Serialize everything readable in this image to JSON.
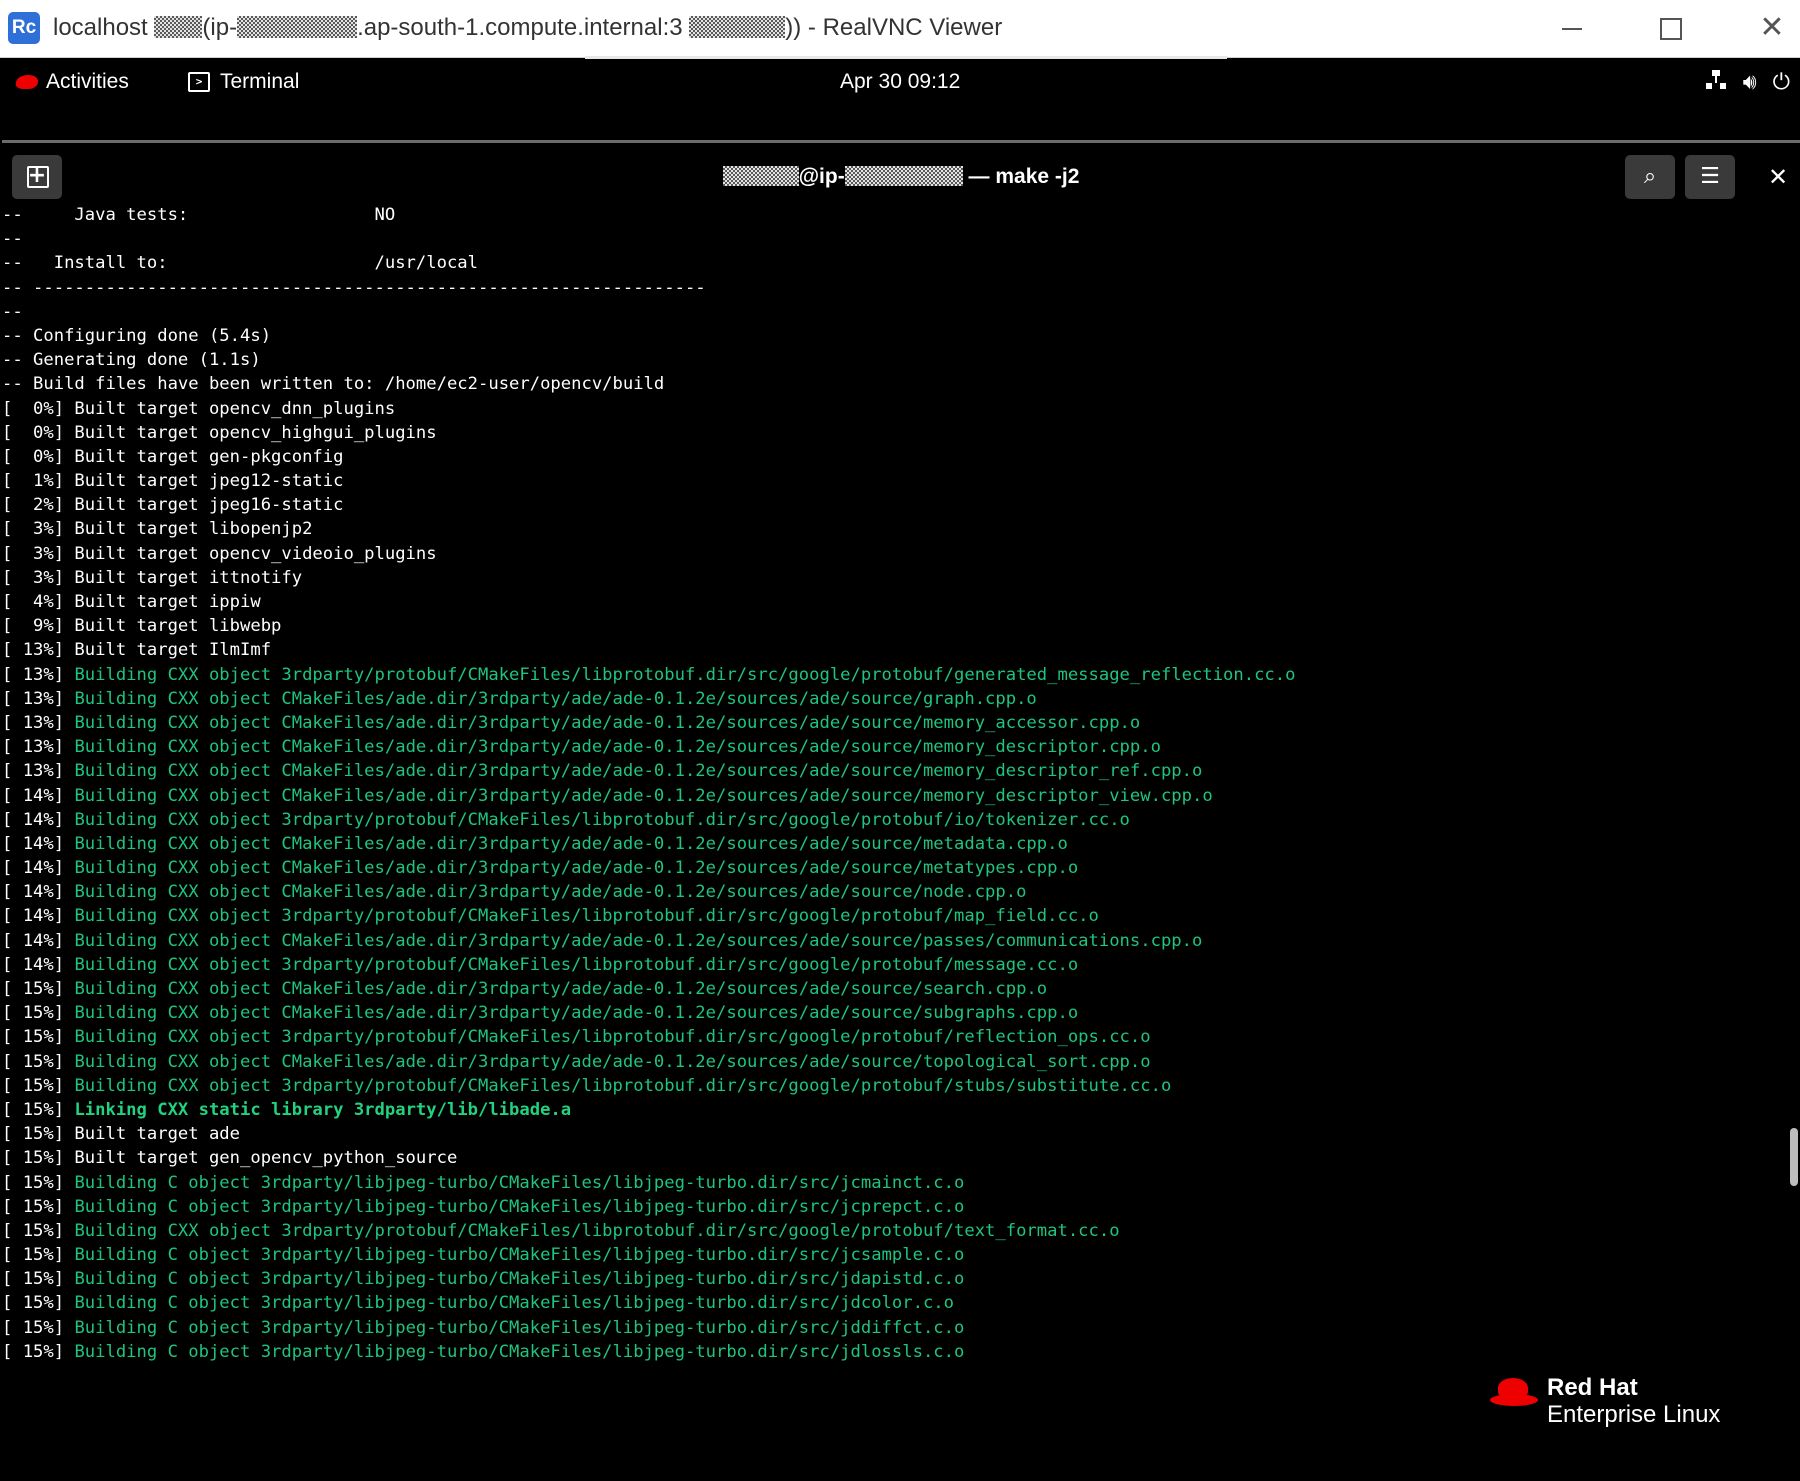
{
  "vnc": {
    "title_prefix": "localhost ",
    "title_mid": "(ip-",
    "title_host": ".ap-south-1.compute.internal:3",
    "title_suffix": ")) - RealVNC Viewer",
    "logo": "Rc"
  },
  "gnome": {
    "activities": "Activities",
    "app": "Terminal",
    "clock": "Apr 30  09:12"
  },
  "terminal": {
    "title_at": "@ip-",
    "title_cmd": " — make -j2",
    "lines": [
      {
        "prefix": "--     Java tests:                  NO",
        "msg": "",
        "style": ""
      },
      {
        "prefix": "--",
        "msg": "",
        "style": ""
      },
      {
        "prefix": "--   Install to:                    /usr/local",
        "msg": "",
        "style": ""
      },
      {
        "prefix": "-- -----------------------------------------------------------------",
        "msg": "",
        "style": ""
      },
      {
        "prefix": "--",
        "msg": "",
        "style": ""
      },
      {
        "prefix": "-- Configuring done (5.4s)",
        "msg": "",
        "style": ""
      },
      {
        "prefix": "-- Generating done (1.1s)",
        "msg": "",
        "style": ""
      },
      {
        "prefix": "-- Build files have been written to: /home/ec2-user/opencv/build",
        "msg": "",
        "style": ""
      },
      {
        "prefix": "[  0%] Built target opencv_dnn_plugins",
        "msg": "",
        "style": ""
      },
      {
        "prefix": "[  0%] Built target opencv_highgui_plugins",
        "msg": "",
        "style": ""
      },
      {
        "prefix": "[  0%] Built target gen-pkgconfig",
        "msg": "",
        "style": ""
      },
      {
        "prefix": "[  1%] Built target jpeg12-static",
        "msg": "",
        "style": ""
      },
      {
        "prefix": "[  2%] Built target jpeg16-static",
        "msg": "",
        "style": ""
      },
      {
        "prefix": "[  3%] Built target libopenjp2",
        "msg": "",
        "style": ""
      },
      {
        "prefix": "[  3%] Built target opencv_videoio_plugins",
        "msg": "",
        "style": ""
      },
      {
        "prefix": "[  3%] Built target ittnotify",
        "msg": "",
        "style": ""
      },
      {
        "prefix": "[  4%] Built target ippiw",
        "msg": "",
        "style": ""
      },
      {
        "prefix": "[  9%] Built target libwebp",
        "msg": "",
        "style": ""
      },
      {
        "prefix": "[ 13%] Built target IlmImf",
        "msg": "",
        "style": ""
      },
      {
        "prefix": "[ 13%] ",
        "msg": "Building CXX object 3rdparty/protobuf/CMakeFiles/libprotobuf.dir/src/google/protobuf/generated_message_reflection.cc.o",
        "style": "green"
      },
      {
        "prefix": "[ 13%] ",
        "msg": "Building CXX object CMakeFiles/ade.dir/3rdparty/ade/ade-0.1.2e/sources/ade/source/graph.cpp.o",
        "style": "green"
      },
      {
        "prefix": "[ 13%] ",
        "msg": "Building CXX object CMakeFiles/ade.dir/3rdparty/ade/ade-0.1.2e/sources/ade/source/memory_accessor.cpp.o",
        "style": "green"
      },
      {
        "prefix": "[ 13%] ",
        "msg": "Building CXX object CMakeFiles/ade.dir/3rdparty/ade/ade-0.1.2e/sources/ade/source/memory_descriptor.cpp.o",
        "style": "green"
      },
      {
        "prefix": "[ 13%] ",
        "msg": "Building CXX object CMakeFiles/ade.dir/3rdparty/ade/ade-0.1.2e/sources/ade/source/memory_descriptor_ref.cpp.o",
        "style": "green"
      },
      {
        "prefix": "[ 14%] ",
        "msg": "Building CXX object CMakeFiles/ade.dir/3rdparty/ade/ade-0.1.2e/sources/ade/source/memory_descriptor_view.cpp.o",
        "style": "green"
      },
      {
        "prefix": "[ 14%] ",
        "msg": "Building CXX object 3rdparty/protobuf/CMakeFiles/libprotobuf.dir/src/google/protobuf/io/tokenizer.cc.o",
        "style": "green"
      },
      {
        "prefix": "[ 14%] ",
        "msg": "Building CXX object CMakeFiles/ade.dir/3rdparty/ade/ade-0.1.2e/sources/ade/source/metadata.cpp.o",
        "style": "green"
      },
      {
        "prefix": "[ 14%] ",
        "msg": "Building CXX object CMakeFiles/ade.dir/3rdparty/ade/ade-0.1.2e/sources/ade/source/metatypes.cpp.o",
        "style": "green"
      },
      {
        "prefix": "[ 14%] ",
        "msg": "Building CXX object CMakeFiles/ade.dir/3rdparty/ade/ade-0.1.2e/sources/ade/source/node.cpp.o",
        "style": "green"
      },
      {
        "prefix": "[ 14%] ",
        "msg": "Building CXX object 3rdparty/protobuf/CMakeFiles/libprotobuf.dir/src/google/protobuf/map_field.cc.o",
        "style": "green"
      },
      {
        "prefix": "[ 14%] ",
        "msg": "Building CXX object CMakeFiles/ade.dir/3rdparty/ade/ade-0.1.2e/sources/ade/source/passes/communications.cpp.o",
        "style": "green"
      },
      {
        "prefix": "[ 14%] ",
        "msg": "Building CXX object 3rdparty/protobuf/CMakeFiles/libprotobuf.dir/src/google/protobuf/message.cc.o",
        "style": "green"
      },
      {
        "prefix": "[ 15%] ",
        "msg": "Building CXX object CMakeFiles/ade.dir/3rdparty/ade/ade-0.1.2e/sources/ade/source/search.cpp.o",
        "style": "green"
      },
      {
        "prefix": "[ 15%] ",
        "msg": "Building CXX object CMakeFiles/ade.dir/3rdparty/ade/ade-0.1.2e/sources/ade/source/subgraphs.cpp.o",
        "style": "green"
      },
      {
        "prefix": "[ 15%] ",
        "msg": "Building CXX object 3rdparty/protobuf/CMakeFiles/libprotobuf.dir/src/google/protobuf/reflection_ops.cc.o",
        "style": "green"
      },
      {
        "prefix": "[ 15%] ",
        "msg": "Building CXX object CMakeFiles/ade.dir/3rdparty/ade/ade-0.1.2e/sources/ade/source/topological_sort.cpp.o",
        "style": "green"
      },
      {
        "prefix": "[ 15%] ",
        "msg": "Building CXX object 3rdparty/protobuf/CMakeFiles/libprotobuf.dir/src/google/protobuf/stubs/substitute.cc.o",
        "style": "green"
      },
      {
        "prefix": "[ 15%] ",
        "msg": "Linking CXX static library 3rdparty/lib/libade.a",
        "style": "greenbold"
      },
      {
        "prefix": "[ 15%] Built target ade",
        "msg": "",
        "style": ""
      },
      {
        "prefix": "[ 15%] Built target gen_opencv_python_source",
        "msg": "",
        "style": ""
      },
      {
        "prefix": "[ 15%] ",
        "msg": "Building C object 3rdparty/libjpeg-turbo/CMakeFiles/libjpeg-turbo.dir/src/jcmainct.c.o",
        "style": "green"
      },
      {
        "prefix": "[ 15%] ",
        "msg": "Building C object 3rdparty/libjpeg-turbo/CMakeFiles/libjpeg-turbo.dir/src/jcprepct.c.o",
        "style": "green"
      },
      {
        "prefix": "[ 15%] ",
        "msg": "Building CXX object 3rdparty/protobuf/CMakeFiles/libprotobuf.dir/src/google/protobuf/text_format.cc.o",
        "style": "green"
      },
      {
        "prefix": "[ 15%] ",
        "msg": "Building C object 3rdparty/libjpeg-turbo/CMakeFiles/libjpeg-turbo.dir/src/jcsample.c.o",
        "style": "green"
      },
      {
        "prefix": "[ 15%] ",
        "msg": "Building C object 3rdparty/libjpeg-turbo/CMakeFiles/libjpeg-turbo.dir/src/jdapistd.c.o",
        "style": "green"
      },
      {
        "prefix": "[ 15%] ",
        "msg": "Building C object 3rdparty/libjpeg-turbo/CMakeFiles/libjpeg-turbo.dir/src/jdcolor.c.o",
        "style": "green"
      },
      {
        "prefix": "[ 15%] ",
        "msg": "Building C object 3rdparty/libjpeg-turbo/CMakeFiles/libjpeg-turbo.dir/src/jddiffct.c.o",
        "style": "green"
      },
      {
        "prefix": "[ 15%] ",
        "msg": "Building C object 3rdparty/libjpeg-turbo/CMakeFiles/libjpeg-turbo.dir/src/jdlossls.c.o",
        "style": "green"
      }
    ]
  },
  "watermark": {
    "line1": "Red Hat",
    "line2": "Enterprise Linux"
  },
  "colors": {
    "build_green": "#1fc47d",
    "redhat_red": "#ee0000",
    "vnc_blue": "#2f6fd8"
  },
  "icons": [
    "realvnc-logo-icon",
    "minimize-icon",
    "maximize-icon",
    "close-icon",
    "redhat-icon",
    "terminal-icon",
    "network-icon",
    "volume-icon",
    "power-icon",
    "new-tab-icon",
    "search-icon",
    "hamburger-menu-icon",
    "close-terminal-icon"
  ]
}
